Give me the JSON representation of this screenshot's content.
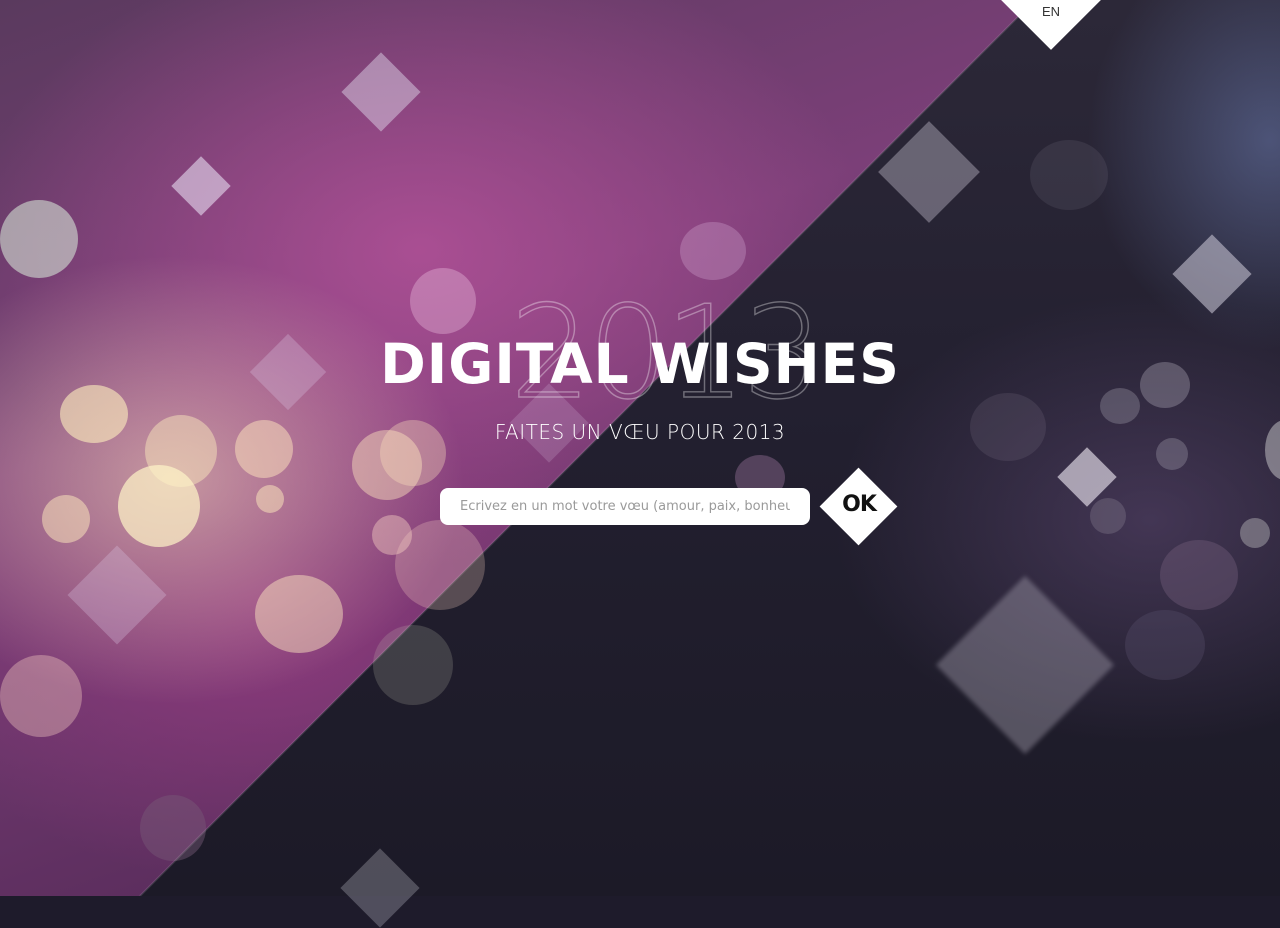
{
  "header": {
    "language_switch": "EN"
  },
  "hero": {
    "year_outline": "2013",
    "title": "DIGITAL WISHES",
    "subtitle": "FAITES UN VŒU POUR 2013"
  },
  "wish_form": {
    "input_placeholder": "Ecrivez en un mot votre vœu (amour, paix, bonheur...)",
    "input_value": "",
    "submit_label": "OK"
  },
  "colors": {
    "left_panel": "#7b3f78",
    "right_panel": "#221f2f",
    "accent": "#ffffff"
  },
  "icons": {
    "language_tab": "diamond-shape",
    "submit": "diamond-shape"
  }
}
